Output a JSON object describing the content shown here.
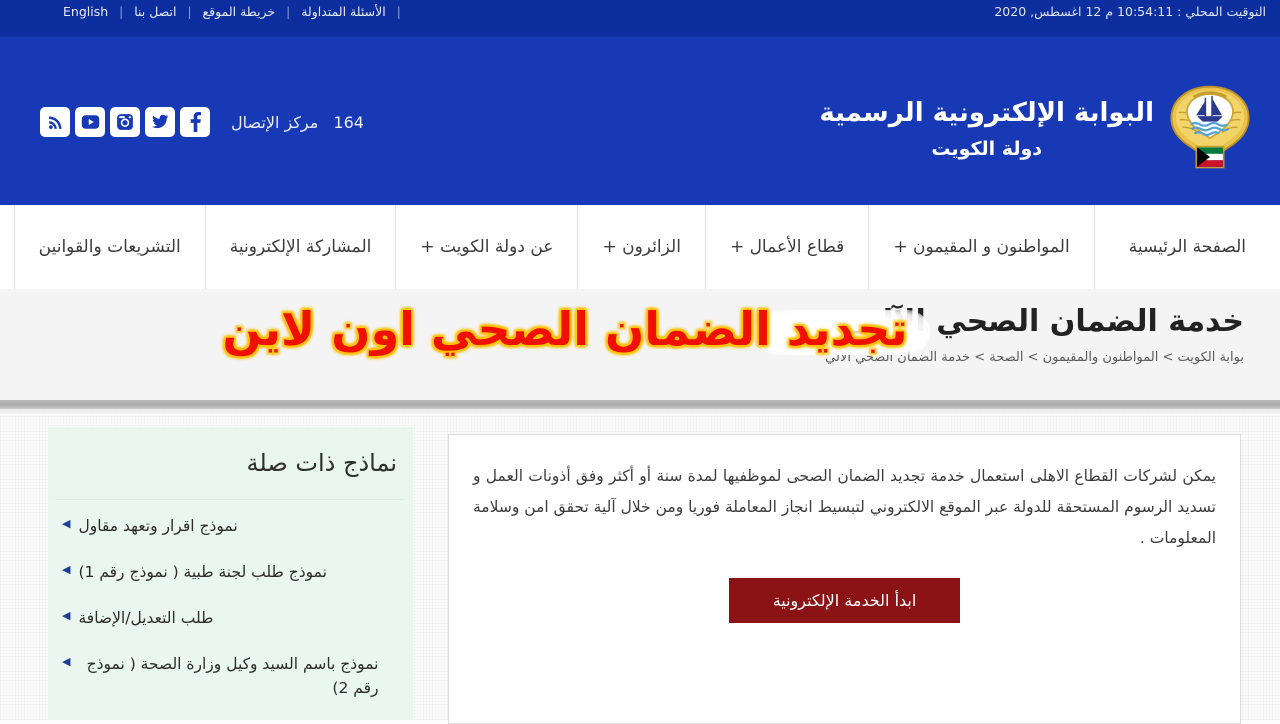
{
  "topbar": {
    "links": [
      "English",
      "اتصل بنا",
      "خريطة الموقع",
      "الأسئلة المتداولة"
    ],
    "separator": "|",
    "local_time": "التوقيت المحلي : 10:54:11 م 12 اغسطس, 2020"
  },
  "header": {
    "social": [
      {
        "name": "rss-icon"
      },
      {
        "name": "youtube-icon"
      },
      {
        "name": "instagram-icon"
      },
      {
        "name": "twitter-icon"
      },
      {
        "name": "facebook-icon"
      }
    ],
    "call_center_number": "164",
    "call_center_label": "مركز الإتصال",
    "brand_title": "البوابة الإلكترونية الرسمية",
    "brand_sub": "دولة  الكويت",
    "emblem_name": "kuwait-state-emblem"
  },
  "nav": {
    "items": [
      "الصفحة الرئيسية",
      "المواطنون و المقيمون +",
      "قطاع الأعمال +",
      "الزائرون +",
      "عن دولة الكويت +",
      "المشاركة الإلكترونية",
      "التشريعات والقوانين"
    ]
  },
  "banner": {
    "title": "خدمة الضمان الصحي الآلي",
    "breadcrumb": "بوابة الكويت > المواطنون والمقيمون > الصحة > خدمة الضمان الصحي الآلي",
    "overlay_text": "تجديد الضمان الصحي اون لاين"
  },
  "main": {
    "paragraph": "يمكن لشركات القطاع الاهلى استعمال خدمة تجديد الضمان الصحى لموظفيها لمدة سنة أو أكثر وفق أذونات العمل و تسديد الرسوم المستحقة للدولة عبر الموقع الالكتروني لتبسيط انجاز المعاملة فوريا ومن خلال آلية تحقق امن وسلامة المعلومات .",
    "start_button": "ابدأ الخدمة الإلكترونية"
  },
  "sidebar": {
    "title": "نماذج ذات صلة",
    "items": [
      "نموذج اقرار وتعهد مقاول",
      "نموذج طلب لجنة طبية ( نموذج رقم 1)",
      "طلب التعديل/الإضافة",
      "نموذج باسم السيد وكيل وزارة الصحة ( نموذج رقم 2)"
    ]
  },
  "colors": {
    "topbar_blue": "#0C2E9E",
    "header_blue": "#1739B6",
    "banner_bg": "#f4f4f4",
    "overlay_red": "#f01000",
    "overlay_glow": "#ffc000",
    "button_red": "#8B1215",
    "sidebar_mint": "#eaf6f0",
    "bullet_blue": "#1c3f94"
  }
}
